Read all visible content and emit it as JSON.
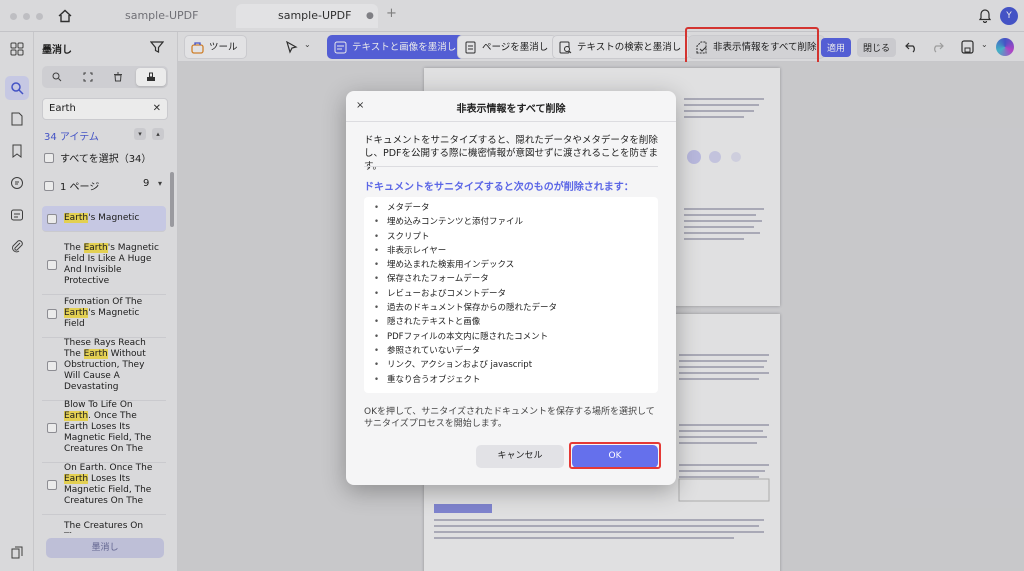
{
  "window": {
    "tabs": [
      {
        "label": "sample-UPDF",
        "active": false
      },
      {
        "label": "sample-UPDF",
        "active": true
      }
    ],
    "avatar_letter": "Y",
    "add_tab": "+"
  },
  "sidebar": {
    "title": "墨消し",
    "search_value": "Earth",
    "result_count": "34 アイテム",
    "select_all": "すべてを選択（34）",
    "page_group": "1 ページ",
    "page_group_count": "9",
    "results": [
      {
        "pre": "",
        "hit": "Earth",
        "post": "'s Magnetic"
      },
      {
        "pre": "The ",
        "hit": "Earth",
        "post": "'s Magnetic Field Is Like A Huge And Invisible Protective"
      },
      {
        "pre": "Formation Of The ",
        "hit": "Earth",
        "post": "'s Magnetic Field"
      },
      {
        "pre": "These Rays Reach The ",
        "hit": "Earth",
        "post": " Without Obstruction, They Will Cause A Devastating"
      },
      {
        "pre": "Blow To Life On ",
        "hit": "Earth",
        "post": ". Once The Earth Loses Its Magnetic Field, The Creatures On The"
      },
      {
        "pre": "On Earth. Once The ",
        "hit": "Earth",
        "post": " Loses Its Magnetic Field, The Creatures On The"
      },
      {
        "pre": "The Creatures On The",
        "hit": "",
        "post": ""
      }
    ],
    "redact_button": "墨消し"
  },
  "toolbar": {
    "tool_label": "ツール",
    "redact_text_image": "テキストと画像を墨消し",
    "redact_page": "ページを墨消し",
    "search_redact": "テキストの検索と墨消し",
    "sanitize": "非表示情報をすべて削除",
    "apply": "適用",
    "close": "閉じる"
  },
  "dialog": {
    "title": "非表示情報をすべて削除",
    "close": "×",
    "description": "ドキュメントをサニタイズすると、隠れたデータやメタデータを削除し、PDFを公開する際に機密情報が意図せずに渡されることを防ぎます。",
    "subtitle": "ドキュメントをサニタイズすると次のものが削除されます：",
    "items": [
      "メタデータ",
      "埋め込みコンテンツと添付ファイル",
      "スクリプト",
      "非表示レイヤー",
      "埋め込まれた検索用インデックス",
      "保存されたフォームデータ",
      "レビューおよびコメントデータ",
      "過去のドキュメント保存からの隠れたデータ",
      "隠されたテキストと画像",
      "PDFファイルの本文内に隠されたコメント",
      "参照されていないデータ",
      "リンク、アクションおよび javascript",
      "重なり合うオブジェクト"
    ],
    "footer": "OKを押して、サニタイズされたドキュメントを保存する場所を選択してサニタイズプロセスを開始します。",
    "cancel": "キャンセル",
    "ok": "OK"
  },
  "colors": {
    "accent": "#5b66e6",
    "highlight": "#f7e25a",
    "annotation_red": "#e53935"
  }
}
